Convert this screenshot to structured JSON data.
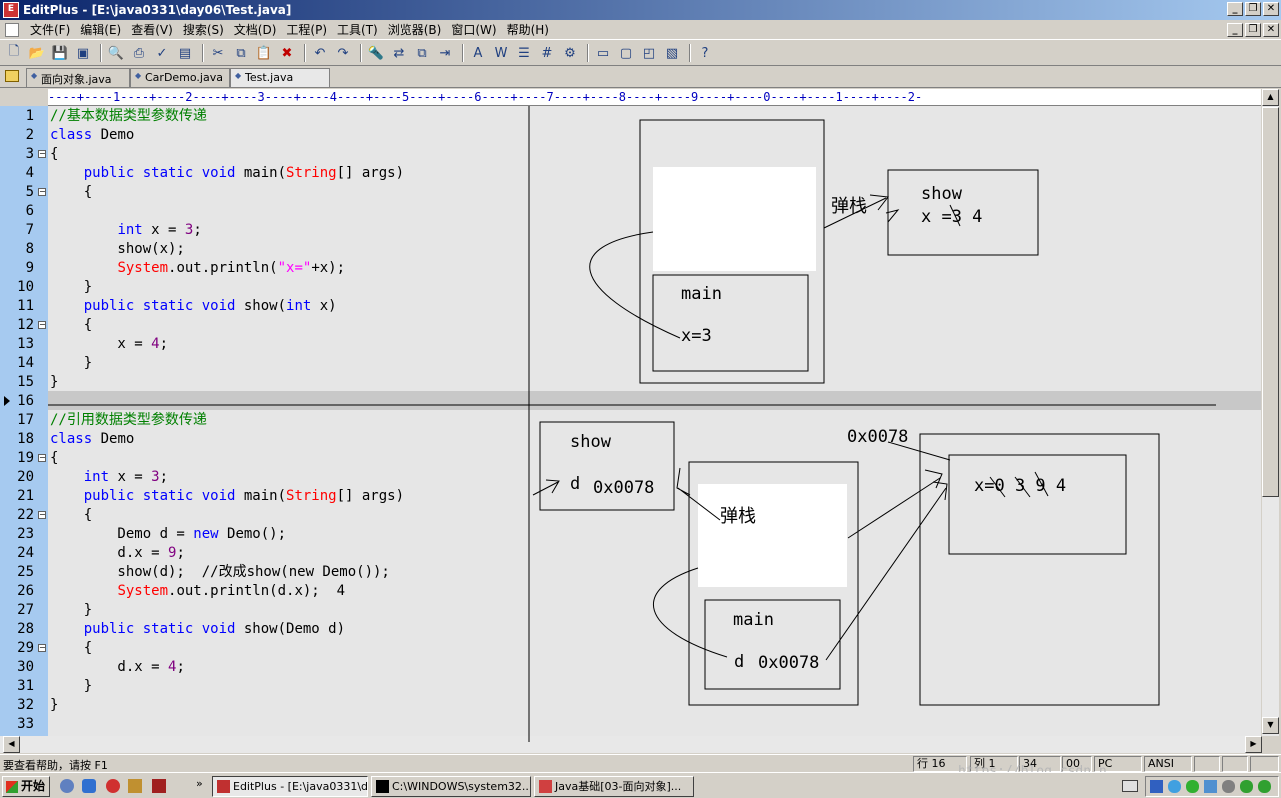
{
  "window": {
    "title": "EditPlus - [E:\\java0331\\day06\\Test.java]",
    "app_icon": "editplus-icon",
    "buttons": [
      "_",
      "❐",
      "✕"
    ]
  },
  "menu": [
    "文件(F)",
    "编辑(E)",
    "查看(V)",
    "搜索(S)",
    "文档(D)",
    "工程(P)",
    "工具(T)",
    "浏览器(B)",
    "窗口(W)",
    "帮助(H)"
  ],
  "tabs": [
    {
      "label": "面向对象.java",
      "active": false
    },
    {
      "label": "CarDemo.java",
      "active": false
    },
    {
      "label": "Test.java",
      "active": true
    }
  ],
  "ruler": "----+----1----+----2----+----3----+----4----+----5----+----6----+----7----+----8----+----9----+----0----+----1----+----2-",
  "code": [
    {
      "n": "1",
      "fold": "",
      "parts": [
        [
          "cmt",
          "//基本数据类型参数传递"
        ]
      ]
    },
    {
      "n": "2",
      "fold": "",
      "parts": [
        [
          "kw",
          "class"
        ],
        [
          "",
          " Demo"
        ]
      ]
    },
    {
      "n": "3",
      "fold": "⊟",
      "parts": [
        [
          "",
          "{"
        ]
      ]
    },
    {
      "n": "4",
      "fold": "",
      "parts": [
        [
          "",
          "    "
        ],
        [
          "kw",
          "public static void"
        ],
        [
          "",
          " main("
        ],
        [
          "cls",
          "String"
        ],
        [
          "",
          "[] args)"
        ]
      ]
    },
    {
      "n": "5",
      "fold": "⊟",
      "parts": [
        [
          "",
          "    {"
        ]
      ]
    },
    {
      "n": "6",
      "fold": "",
      "parts": [
        [
          "",
          ""
        ]
      ]
    },
    {
      "n": "7",
      "fold": "",
      "parts": [
        [
          "",
          "        "
        ],
        [
          "kw",
          "int"
        ],
        [
          "",
          " x = "
        ],
        [
          "num",
          "3"
        ],
        [
          "",
          ";"
        ]
      ]
    },
    {
      "n": "8",
      "fold": "",
      "parts": [
        [
          "",
          "        show(x);"
        ]
      ]
    },
    {
      "n": "9",
      "fold": "",
      "parts": [
        [
          "",
          "        "
        ],
        [
          "cls",
          "System"
        ],
        [
          "",
          ".out.println("
        ],
        [
          "str",
          "\"x=\""
        ],
        [
          "",
          "+x);"
        ]
      ]
    },
    {
      "n": "10",
      "fold": "",
      "parts": [
        [
          "",
          "    }"
        ]
      ]
    },
    {
      "n": "11",
      "fold": "",
      "parts": [
        [
          "",
          "    "
        ],
        [
          "kw",
          "public static void"
        ],
        [
          "",
          " show("
        ],
        [
          "kw",
          "int"
        ],
        [
          "",
          " x)"
        ]
      ]
    },
    {
      "n": "12",
      "fold": "⊟",
      "parts": [
        [
          "",
          "    {"
        ]
      ]
    },
    {
      "n": "13",
      "fold": "",
      "parts": [
        [
          "",
          "        x = "
        ],
        [
          "num",
          "4"
        ],
        [
          "",
          ";"
        ]
      ]
    },
    {
      "n": "14",
      "fold": "",
      "parts": [
        [
          "",
          "    }"
        ]
      ]
    },
    {
      "n": "15",
      "fold": "",
      "parts": [
        [
          "",
          "}"
        ]
      ]
    },
    {
      "n": "16",
      "fold": "",
      "parts": [
        [
          "",
          ""
        ]
      ]
    },
    {
      "n": "17",
      "fold": "",
      "parts": [
        [
          "cmt",
          "//引用数据类型参数传递"
        ]
      ]
    },
    {
      "n": "18",
      "fold": "",
      "parts": [
        [
          "kw",
          "class"
        ],
        [
          "",
          " Demo"
        ]
      ]
    },
    {
      "n": "19",
      "fold": "⊟",
      "parts": [
        [
          "",
          "{"
        ]
      ]
    },
    {
      "n": "20",
      "fold": "",
      "parts": [
        [
          "",
          "    "
        ],
        [
          "kw",
          "int"
        ],
        [
          "",
          " x = "
        ],
        [
          "num",
          "3"
        ],
        [
          "",
          ";"
        ]
      ]
    },
    {
      "n": "21",
      "fold": "",
      "parts": [
        [
          "",
          "    "
        ],
        [
          "kw",
          "public static void"
        ],
        [
          "",
          " main("
        ],
        [
          "cls",
          "String"
        ],
        [
          "",
          "[] args)"
        ]
      ]
    },
    {
      "n": "22",
      "fold": "⊟",
      "parts": [
        [
          "",
          "    {"
        ]
      ]
    },
    {
      "n": "23",
      "fold": "",
      "parts": [
        [
          "",
          "        Demo d = "
        ],
        [
          "kw",
          "new"
        ],
        [
          "",
          " Demo();"
        ]
      ]
    },
    {
      "n": "24",
      "fold": "",
      "parts": [
        [
          "",
          "        d.x = "
        ],
        [
          "num",
          "9"
        ],
        [
          "",
          ";"
        ]
      ]
    },
    {
      "n": "25",
      "fold": "",
      "parts": [
        [
          "",
          "        show(d);  //改成show(new Demo());"
        ]
      ]
    },
    {
      "n": "26",
      "fold": "",
      "parts": [
        [
          "",
          "        "
        ],
        [
          "cls",
          "System"
        ],
        [
          "",
          ".out.println(d.x);  4"
        ]
      ]
    },
    {
      "n": "27",
      "fold": "",
      "parts": [
        [
          "",
          "    }"
        ]
      ]
    },
    {
      "n": "28",
      "fold": "",
      "parts": [
        [
          "",
          "    "
        ],
        [
          "kw",
          "public static void"
        ],
        [
          "",
          " show(Demo d)"
        ]
      ]
    },
    {
      "n": "29",
      "fold": "⊟",
      "parts": [
        [
          "",
          "    {"
        ]
      ]
    },
    {
      "n": "30",
      "fold": "",
      "parts": [
        [
          "",
          "        d.x = "
        ],
        [
          "num",
          "4"
        ],
        [
          "",
          ";"
        ]
      ]
    },
    {
      "n": "31",
      "fold": "",
      "parts": [
        [
          "",
          "    }"
        ]
      ]
    },
    {
      "n": "32",
      "fold": "",
      "parts": [
        [
          "",
          "}"
        ]
      ]
    },
    {
      "n": "33",
      "fold": "",
      "parts": [
        [
          "",
          ""
        ]
      ]
    }
  ],
  "annotations": {
    "top": {
      "show_label": "show",
      "show_var": "x =3 4",
      "pop_stack": "弹栈",
      "main_label": "main",
      "main_var": "x=3"
    },
    "bottom": {
      "show_label": "show",
      "show_d": "d",
      "show_addr": "0x0078",
      "pop_stack": "弹栈",
      "main_label": "main",
      "main_d": "d",
      "main_addr": "0x0078",
      "heap_addr": "0x0078",
      "heap_var": "x=0 3 9 4"
    }
  },
  "status": {
    "help": "要查看帮助，请按 F1",
    "line": "行 16",
    "col": "列 1",
    "c34": "34",
    "c00": "00",
    "pc": "PC",
    "enc": "ANSI"
  },
  "taskbar": {
    "start": "开始",
    "tasks": [
      {
        "label": "EditPlus - [E:\\java0331\\d...",
        "active": true
      },
      {
        "label": "C:\\WINDOWS\\system32...",
        "active": false
      },
      {
        "label": "Java基础[03-面向对象]...",
        "active": false
      }
    ],
    "watermark": "https://blog.csdn.n"
  },
  "colors": {
    "gutter": "#a6caf0",
    "keyword": "#0000ff",
    "class": "#ff0000",
    "number": "#800080",
    "string": "#ff00ff",
    "comment": "#008000"
  }
}
